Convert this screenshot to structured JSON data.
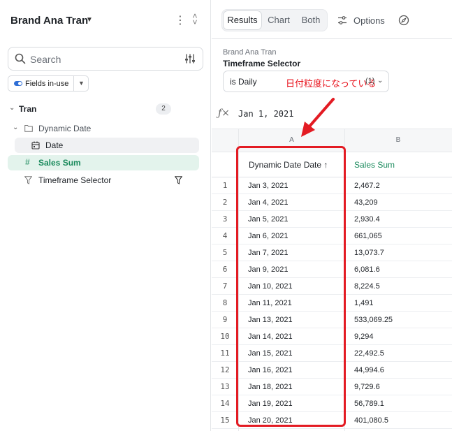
{
  "sidebar": {
    "title": "Brand Ana Tran",
    "search_placeholder": "Search",
    "fields_chip": "Fields in-use",
    "tree": {
      "group_label": "Tran",
      "group_count": "2",
      "folder_label": "Dynamic Date",
      "date_label": "Date",
      "sales_label": "Sales Sum",
      "selector_label": "Timeframe Selector"
    }
  },
  "toolbar": {
    "tabs": [
      "Results",
      "Chart",
      "Both"
    ],
    "active_tab": "Results",
    "options_label": "Options"
  },
  "timeframe": {
    "subtitle": "Brand Ana Tran",
    "title": "Timeframe Selector",
    "value": "is Daily",
    "annotation": "日付粒度になっている",
    "count": "(1)"
  },
  "formula": {
    "value": "Jan 1, 2021"
  },
  "table": {
    "columns": [
      "A",
      "B"
    ],
    "headers": {
      "a": "Dynamic Date Date ↑",
      "b": "Sales Sum"
    },
    "rows": [
      {
        "n": "1",
        "date": "Jan 3, 2021",
        "sales": "2,467.2"
      },
      {
        "n": "2",
        "date": "Jan 4, 2021",
        "sales": "43,209"
      },
      {
        "n": "3",
        "date": "Jan 5, 2021",
        "sales": "2,930.4"
      },
      {
        "n": "4",
        "date": "Jan 6, 2021",
        "sales": "661,065"
      },
      {
        "n": "5",
        "date": "Jan 7, 2021",
        "sales": "13,073.7"
      },
      {
        "n": "6",
        "date": "Jan 9, 2021",
        "sales": "6,081.6"
      },
      {
        "n": "7",
        "date": "Jan 10, 2021",
        "sales": "8,224.5"
      },
      {
        "n": "8",
        "date": "Jan 11, 2021",
        "sales": "1,491"
      },
      {
        "n": "9",
        "date": "Jan 13, 2021",
        "sales": "533,069.25"
      },
      {
        "n": "10",
        "date": "Jan 14, 2021",
        "sales": "9,294"
      },
      {
        "n": "11",
        "date": "Jan 15, 2021",
        "sales": "22,492.5"
      },
      {
        "n": "12",
        "date": "Jan 16, 2021",
        "sales": "44,994.6"
      },
      {
        "n": "13",
        "date": "Jan 18, 2021",
        "sales": "9,729.6"
      },
      {
        "n": "14",
        "date": "Jan 19, 2021",
        "sales": "56,789.1"
      },
      {
        "n": "15",
        "date": "Jan 20, 2021",
        "sales": "401,080.5"
      }
    ]
  },
  "colors": {
    "accent_green": "#1a8a5c",
    "annotation_red": "#e31b23",
    "toggle_blue": "#2f6fd6"
  }
}
